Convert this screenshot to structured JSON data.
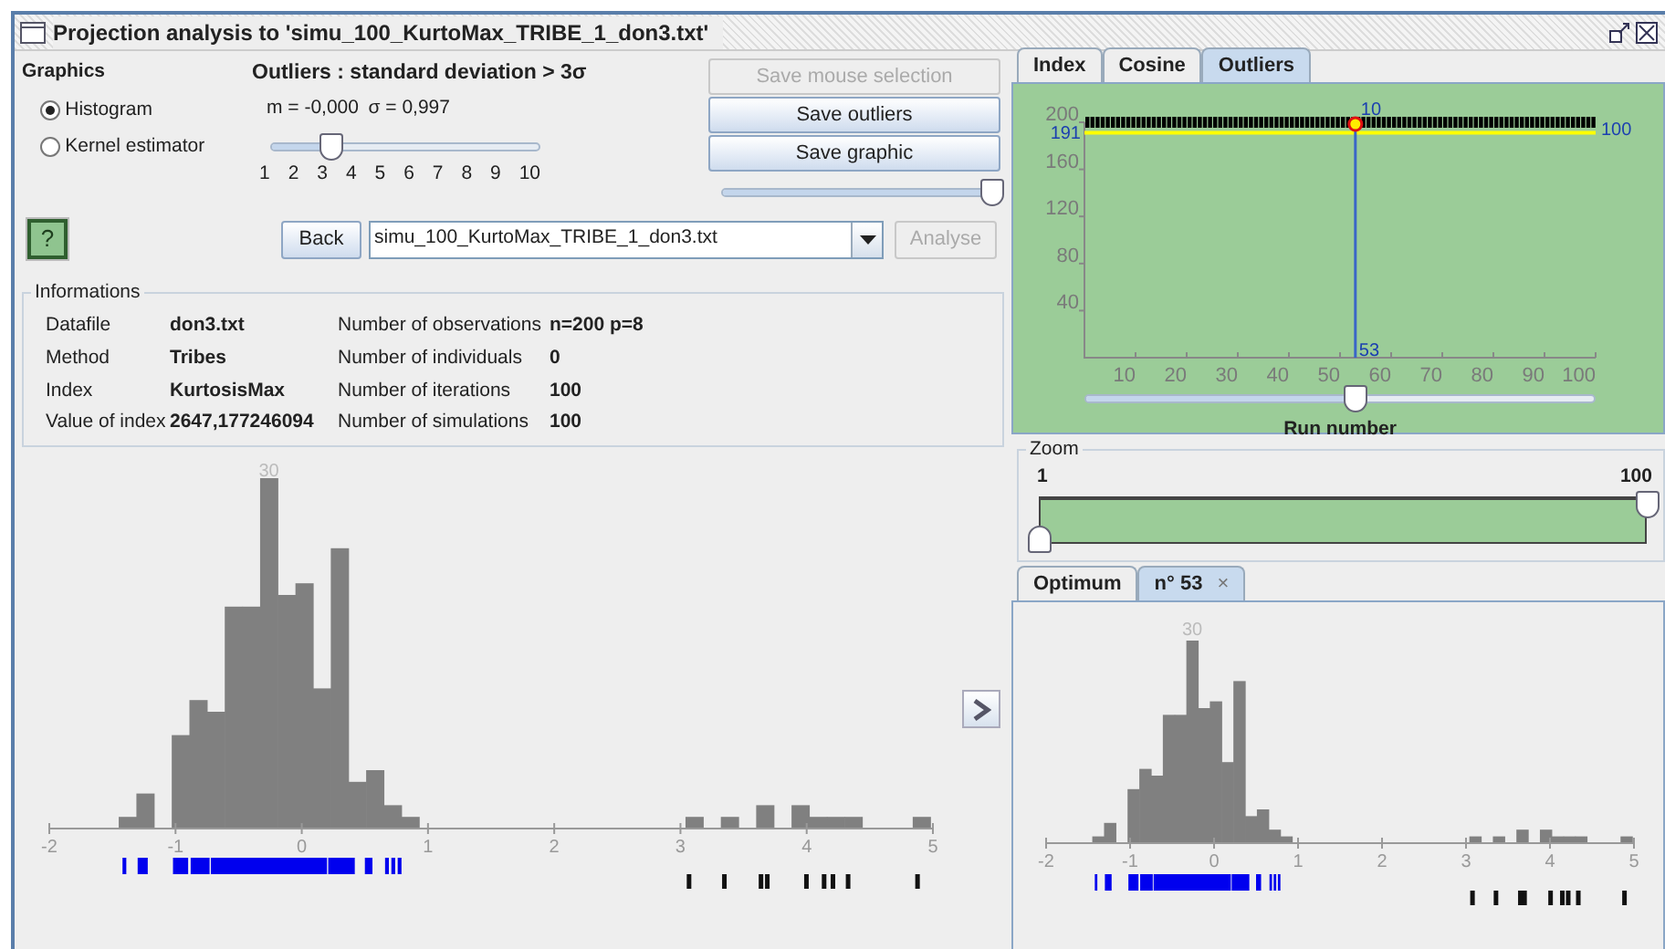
{
  "window": {
    "title": "Projection analysis to 'simu_100_KurtoMax_TRIBE_1_don3.txt'"
  },
  "graphics": {
    "title": "Graphics",
    "options": [
      {
        "label": "Histogram",
        "selected": true
      },
      {
        "label": "Kernel estimator",
        "selected": false
      }
    ]
  },
  "outliers": {
    "title": "Outliers : standard deviation > 3σ",
    "mean": "m = -0,000",
    "sigma": "σ = 0,997",
    "slider": {
      "level": 0.222
    },
    "ticks": [
      "1",
      "2",
      "3",
      "4",
      "5",
      "6",
      "7",
      "8",
      "9",
      "10"
    ]
  },
  "actions": [
    {
      "label": "Save mouse selection",
      "disabled": true
    },
    {
      "label": "Save outliers",
      "disabled": false
    },
    {
      "label": "Save graphic",
      "disabled": false
    }
  ],
  "size_slider": {
    "level": 1
  },
  "help": "?",
  "navigation": {
    "back": "Back",
    "file": "simu_100_KurtoMax_TRIBE_1_don3.txt",
    "analyse": {
      "label": "Analyse",
      "disabled": true
    }
  },
  "informations": {
    "title": "Informations",
    "rows": [
      {
        "label": "Datafile",
        "value": "don3.txt",
        "label_2": "Number of observations",
        "value_2": "n=200 p=8"
      },
      {
        "label": "Method",
        "value": "Tribes",
        "label_2": "Number of individuals",
        "value_2": "0"
      },
      {
        "label": "Index",
        "value": "KurtosisMax",
        "label_2": "Number of iterations",
        "value_2": "100"
      },
      {
        "label": "Value of index",
        "value": "2647,177246094",
        "label_2": "Number of simulations",
        "value_2": "100"
      }
    ]
  },
  "histogram": {
    "peak_label": "30",
    "x_ticks": [
      "-2",
      "-1",
      "0",
      "1",
      "2",
      "3",
      "4",
      "5"
    ]
  },
  "right_tabs": [
    {
      "label": "Index",
      "selected": false
    },
    {
      "label": "Cosine",
      "selected": false
    },
    {
      "label": "Outliers",
      "selected": true
    }
  ],
  "run_chart": {
    "y_ticks": [
      "200",
      "160",
      "120",
      "80",
      "40"
    ],
    "x_ticks": [
      "10",
      "20",
      "30",
      "40",
      "50",
      "60",
      "70",
      "80",
      "90",
      "100"
    ],
    "top_label": "10",
    "left_label": "191",
    "right_label": "100",
    "run_label": "53",
    "slider": {
      "level": 0.53
    },
    "caption": "Run number"
  },
  "zoom": {
    "title": "Zoom",
    "min": "1",
    "max": "100"
  },
  "result_tabs": [
    {
      "label": "Optimum",
      "selected": false
    },
    {
      "label": "n° 53",
      "selected": true,
      "close": "×"
    }
  ],
  "result_histogram": {
    "peak_label": "30",
    "x_ticks": [
      "-2",
      "-1",
      "0",
      "1",
      "2",
      "3",
      "4",
      "5"
    ]
  }
}
